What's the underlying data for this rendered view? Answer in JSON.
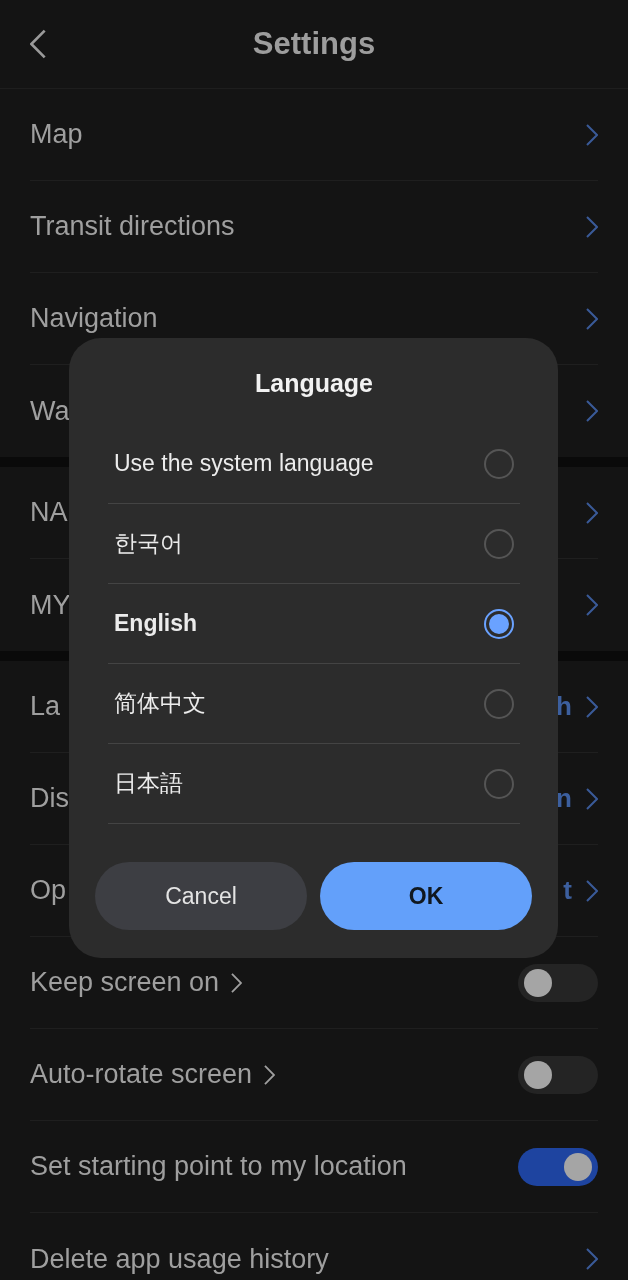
{
  "header": {
    "title": "Settings"
  },
  "sections": [
    {
      "items": [
        {
          "kind": "link",
          "label": "Map"
        },
        {
          "kind": "link",
          "label": "Transit directions"
        },
        {
          "kind": "link",
          "label": "Navigation"
        },
        {
          "kind": "link",
          "label": "Wa"
        }
      ]
    },
    {
      "items": [
        {
          "kind": "link",
          "label": "NA"
        },
        {
          "kind": "link",
          "label": "MY"
        }
      ]
    },
    {
      "items": [
        {
          "kind": "link",
          "label": "La",
          "value": "h"
        },
        {
          "kind": "link",
          "label": "Dis",
          "value": "n"
        },
        {
          "kind": "link",
          "label": "Op",
          "value": "t"
        },
        {
          "kind": "toggle",
          "label": "Keep screen on",
          "arrow": true,
          "on": false
        },
        {
          "kind": "toggle",
          "label": "Auto-rotate screen",
          "arrow": true,
          "on": false
        },
        {
          "kind": "toggle",
          "label": "Set starting point to my location",
          "arrow": false,
          "on": true
        },
        {
          "kind": "link",
          "label": "Delete app usage history"
        }
      ]
    }
  ],
  "dialog": {
    "title": "Language",
    "options": [
      {
        "label": "Use the system language",
        "selected": false
      },
      {
        "label": "한국어",
        "selected": false
      },
      {
        "label": "English",
        "selected": true
      },
      {
        "label": "简体中文",
        "selected": false
      },
      {
        "label": "日本語",
        "selected": false
      }
    ],
    "buttons": [
      {
        "label": "Cancel",
        "kind": "secondary"
      },
      {
        "label": "OK",
        "kind": "primary"
      }
    ]
  }
}
